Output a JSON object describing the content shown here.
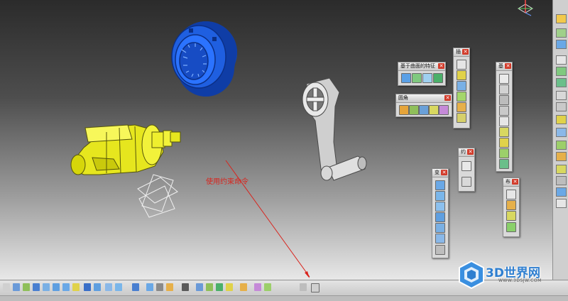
{
  "viewport": {
    "annotation_text": "使用约束命令"
  },
  "toolbars": {
    "surface_based_features": {
      "title": "基于曲面的特征"
    },
    "dress_up": {
      "title": "圆角"
    },
    "insert_tools": {
      "title": "插"
    },
    "sketch_based": {
      "title": "基"
    },
    "constraints": {
      "title": "约"
    },
    "transformations": {
      "title": "变"
    },
    "boolean": {
      "title": "布"
    },
    "close_symbol": "✕"
  },
  "watermark": {
    "text": "3D世界网",
    "url": "WWW.3DSJW.COM"
  },
  "icon_names": [
    "compass-icon",
    "cylinder-part-icon",
    "gear-ring-part-icon",
    "crank-handle-part-icon",
    "axis-system-icon",
    "pad-icon",
    "fillet-icon",
    "rotate-icon",
    "zoom-icon",
    "measure-icon"
  ],
  "colors": {
    "blue_part": "#1f5fe0",
    "yellow_part": "#e6e61e",
    "annotation": "#d9231c",
    "watermark": "#2f7fd0",
    "toolbar_bg": "#d9d9d9",
    "close_button": "#d23b2a"
  }
}
